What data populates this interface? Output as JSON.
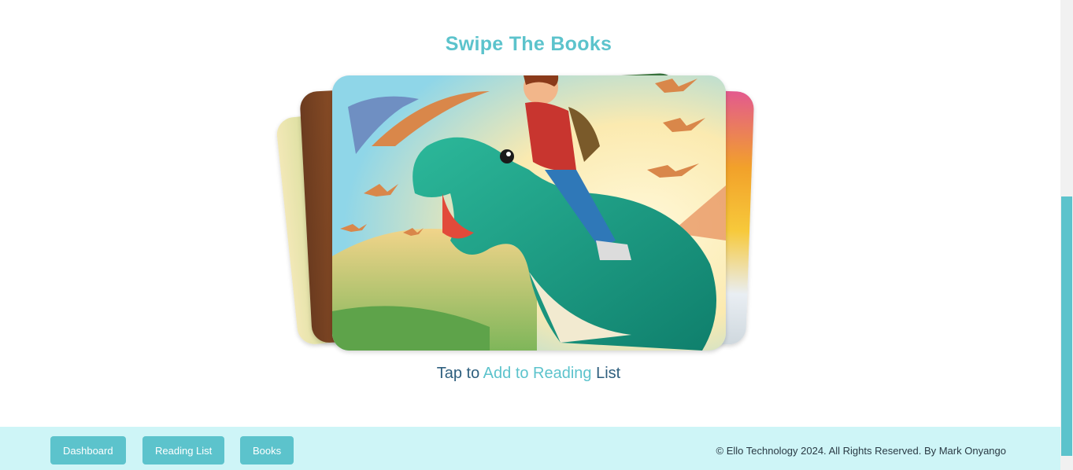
{
  "section": {
    "title": "Swipe The Books"
  },
  "caption": {
    "prefix": "Tap to ",
    "accent": "Add to Reading",
    "suffix": " List"
  },
  "footer": {
    "nav": [
      {
        "label": "Dashboard"
      },
      {
        "label": "Reading List"
      },
      {
        "label": "Books"
      }
    ],
    "copyright": "© Ello Technology 2024. All Rights Reserved. By Mark Onyango"
  },
  "colors": {
    "accent": "#5cc3cc",
    "footer_bg": "#cef5f7",
    "caption_text": "#2e5f7e"
  },
  "book_cover": {
    "icon": "dinosaur-rider-illustration"
  }
}
